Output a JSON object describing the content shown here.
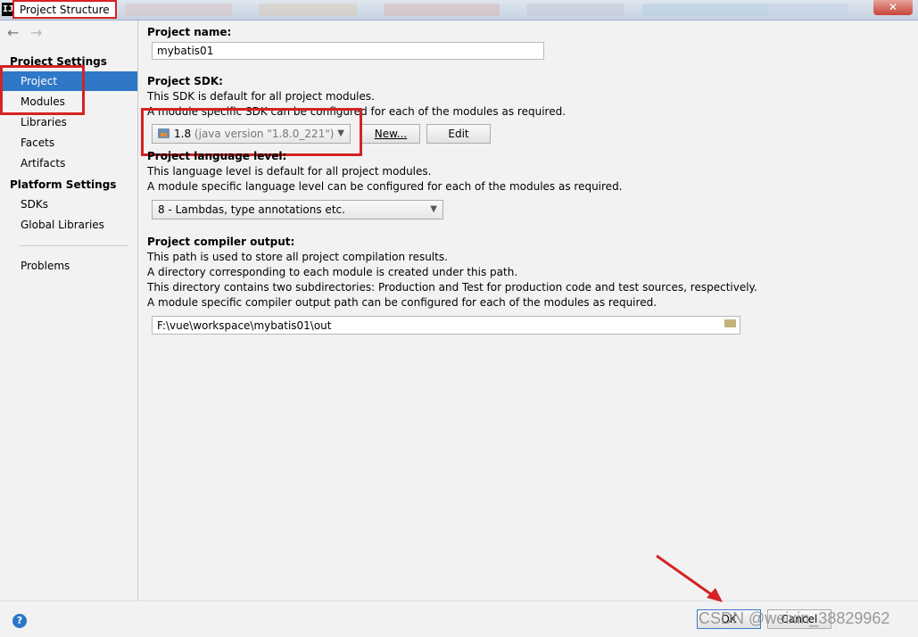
{
  "window": {
    "title": "Project Structure",
    "close_glyph": "✕"
  },
  "nav": {
    "back": "←",
    "forward": "→"
  },
  "sidebar": {
    "project_settings_header": "Project Settings",
    "platform_settings_header": "Platform Settings",
    "project_items": [
      "Project",
      "Modules",
      "Libraries",
      "Facets",
      "Artifacts"
    ],
    "platform_items": [
      "SDKs",
      "Global Libraries"
    ],
    "problems": "Problems",
    "selected": "Project"
  },
  "main": {
    "project_name": {
      "label": "Project name:",
      "value": "mybatis01"
    },
    "sdk": {
      "label": "Project SDK:",
      "desc1": "This SDK is default for all project modules.",
      "desc2": "A module specific SDK can be configured for each of the modules as required.",
      "selected_version": "1.8",
      "selected_detail": "(java version \"1.8.0_221\")",
      "new_button": "New...",
      "edit_button": "Edit"
    },
    "language_level": {
      "label": "Project language level:",
      "desc1": "This language level is default for all project modules.",
      "desc2": "A module specific language level can be configured for each of the modules as required.",
      "selected": "8 - Lambdas, type annotations etc."
    },
    "compiler_output": {
      "label": "Project compiler output:",
      "desc1": "This path is used to store all project compilation results.",
      "desc2": "A directory corresponding to each module is created under this path.",
      "desc3": "This directory contains two subdirectories: Production and Test for production code and test sources, respectively.",
      "desc4": "A module specific compiler output path can be configured for each of the modules as required.",
      "path": "F:\\vue\\workspace\\mybatis01\\out"
    }
  },
  "footer": {
    "help": "?",
    "ok": "OK",
    "cancel": "Cancel",
    "watermark": "CSDN @weixin_38829962"
  },
  "colors": {
    "selection": "#2e78c7",
    "annotation_red": "#d42323"
  }
}
